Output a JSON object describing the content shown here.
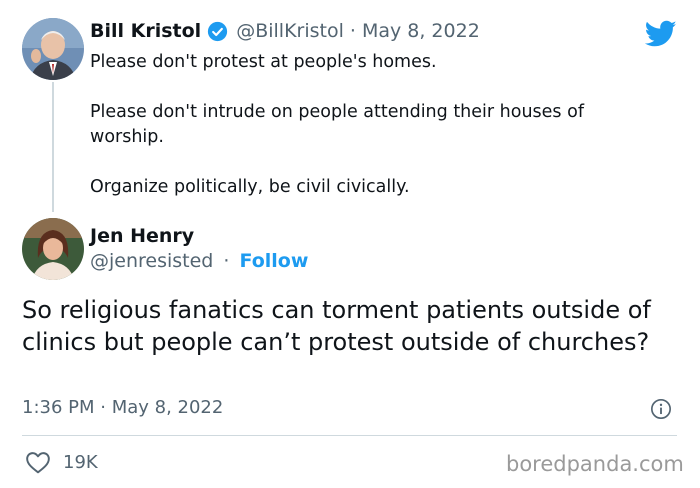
{
  "quoted_tweet": {
    "author_name": "Bill Kristol",
    "handle": "@BillKristol",
    "separator": "·",
    "date": "May 8, 2022",
    "paragraphs": [
      "Please don't protest at people's homes.",
      "Please don't intrude on people attending their houses of worship.",
      "Organize politically, be civil civically."
    ]
  },
  "reply_tweet": {
    "author_name": "Jen Henry",
    "handle": "@jenresisted",
    "separator": "·",
    "follow_label": "Follow",
    "text": "So religious fanatics can torment patients outside of clinics but people can’t protest outside of churches?",
    "timestamp": "1:36 PM · May 8, 2022",
    "like_count": "19K"
  },
  "watermark": "boredpanda.com",
  "colors": {
    "accent": "#1d9bf0",
    "verified": "#1d9bf0",
    "muted": "#536471"
  },
  "icons": [
    "twitter-bird-icon",
    "verified-badge-icon",
    "info-icon",
    "heart-icon"
  ]
}
